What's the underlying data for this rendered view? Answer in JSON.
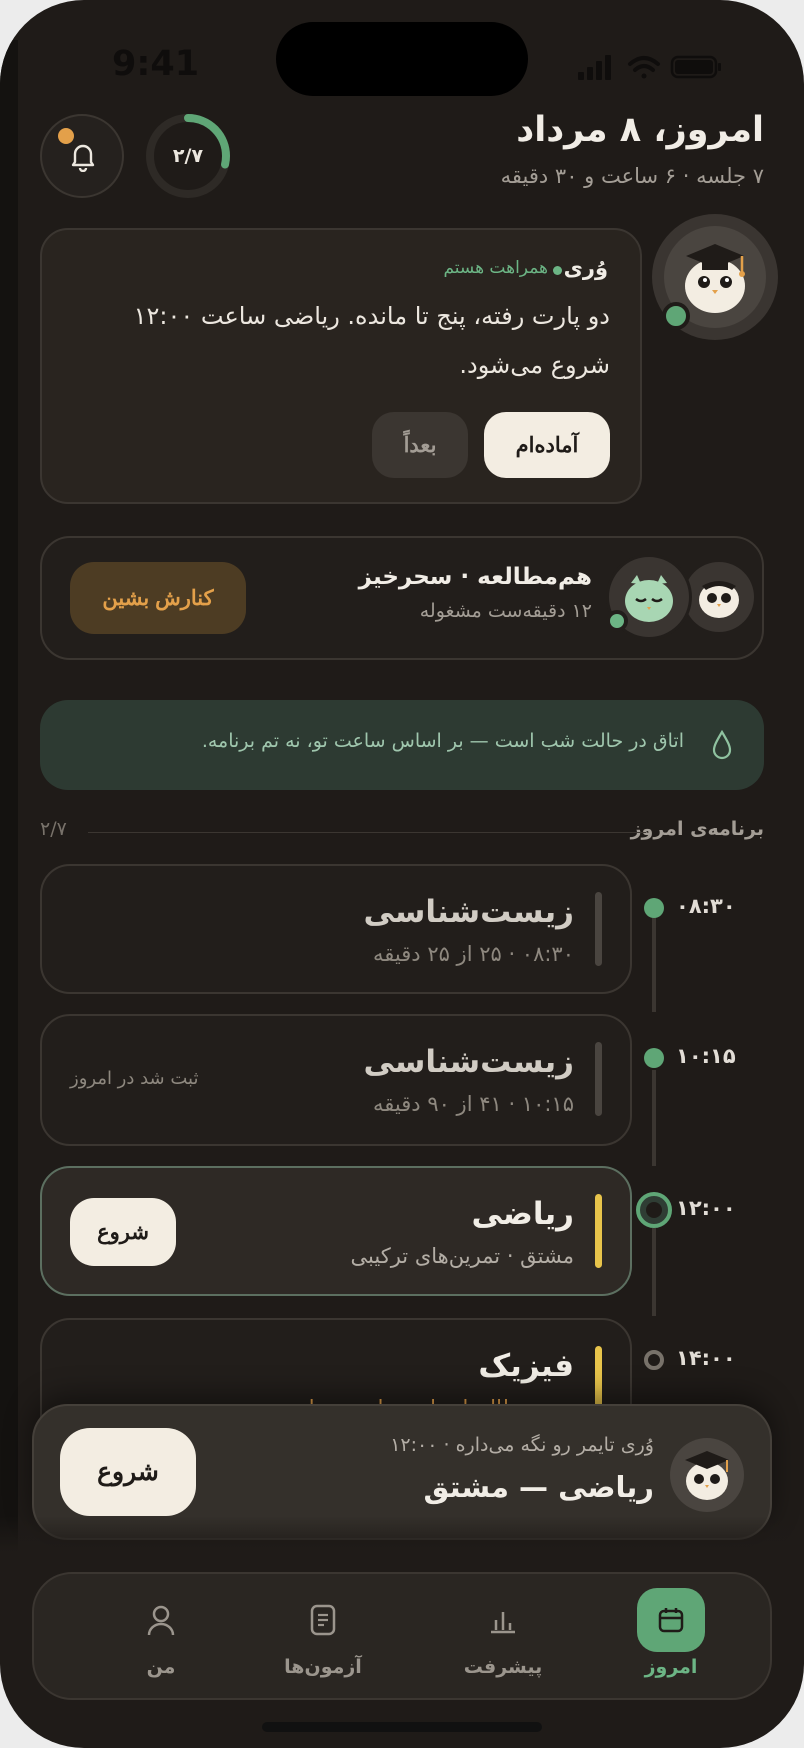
{
  "status_bar": {
    "time": "9:41"
  },
  "header": {
    "title": "امروز، ۸ مرداد",
    "subtitle": "۷ جلسه · ۶ ساعت و ۳۰ دقیقه",
    "progress_text": "۲/۷",
    "progress_fraction": 0.2857,
    "icons": {
      "bell": "bell-icon",
      "notification_dot": "notification-dot"
    }
  },
  "assistant": {
    "name": "وُری",
    "status": "همراهت هستم",
    "message": "دو پارت رفته، پنج تا مانده. ریاضی ساعت ۱۲:۰۰ شروع می‌شود.",
    "ready_label": "آماده‌ام",
    "later_label": "بعداً"
  },
  "cowork": {
    "title": "هم‌مطالعه · سحرخیز",
    "subtitle": "۱۲ دقیقه‌ست مشغوله",
    "sit_label": "کنارش بشین"
  },
  "night_banner": {
    "text": "اتاق در حالت شب است — بر اساس ساعت تو، نه تم برنامه.",
    "icon": "drop-icon"
  },
  "schedule": {
    "title": "برنامه‌ی امروز",
    "count": "۲/۷",
    "items": [
      {
        "time": "۰۸:۳۰",
        "title": "زیست‌شناسی",
        "subtitle": "۰۸:۳۰ · ۲۵ از ۲۵ دقیقه",
        "state": "done"
      },
      {
        "time": "۱۰:۱۵",
        "title": "زیست‌شناسی",
        "subtitle": "۱۰:۱۵ · ۴۱ از ۹۰ دقیقه",
        "note": "ثبت شد در امروز",
        "state": "done"
      },
      {
        "time": "۱۲:۰۰",
        "title": "ریاضی",
        "subtitle": "مشتق · تمرین‌های ترکیبی",
        "action": "شروع",
        "state": "current"
      },
      {
        "time": "۱۴:۰۰",
        "title": "فیزیک",
        "subtitle": "هم‌مطالعه‌ات این ساعت بیداره",
        "state": "upcoming"
      }
    ]
  },
  "now_bar": {
    "subtitle": "وُری تایمر رو نگه می‌داره · ۱۲:۰۰",
    "title": "ریاضی — مشتق",
    "start_label": "شروع"
  },
  "tabbar": {
    "tabs": [
      {
        "label": "امروز",
        "icon": "calendar-icon",
        "active": true
      },
      {
        "label": "پیشرفت",
        "icon": "chart-icon",
        "active": false
      },
      {
        "label": "آزمون‌ها",
        "icon": "document-icon",
        "active": false
      },
      {
        "label": "من",
        "icon": "person-icon",
        "active": false
      }
    ]
  },
  "colors": {
    "accent": "#5fa676",
    "warning": "#e3a04a",
    "highlight": "#e8c44b",
    "background": "#1f1b18"
  }
}
